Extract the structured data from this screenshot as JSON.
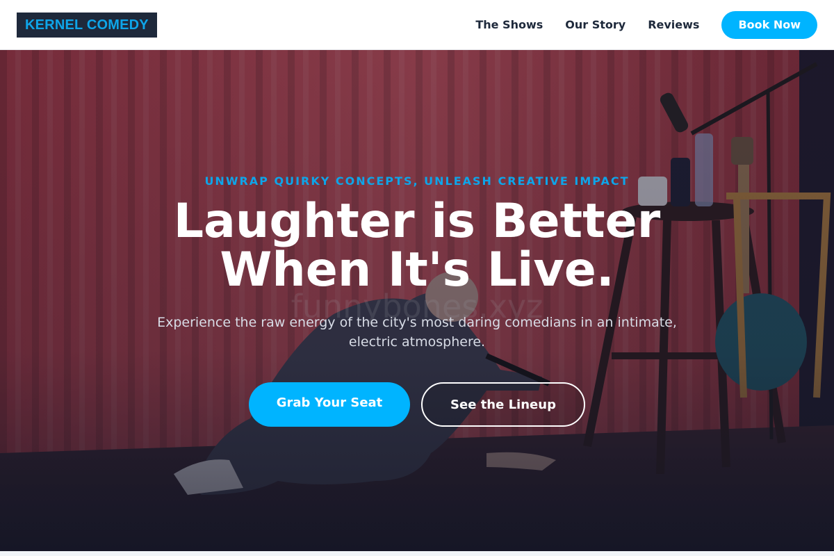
{
  "header": {
    "logo": "KERNEL COMEDY",
    "nav": {
      "shows": "The Shows",
      "story": "Our Story",
      "reviews": "Reviews"
    },
    "book_label": "Book Now"
  },
  "hero": {
    "eyebrow": "UNWRAP QUIRKY CONCEPTS, UNLEASH CREATIVE IMPACT",
    "headline": "Laughter is Better When It's Live.",
    "subtitle": "Experience the raw energy of the city's most daring comedians in an intimate, electric atmosphere.",
    "primary_cta": "Grab Your Seat",
    "secondary_cta": "See the Lineup",
    "background_image": "comedian-on-stage-photo"
  },
  "colors": {
    "accent": "#00b4ff",
    "navy": "#1e293b",
    "curtain": "#b8424e"
  }
}
